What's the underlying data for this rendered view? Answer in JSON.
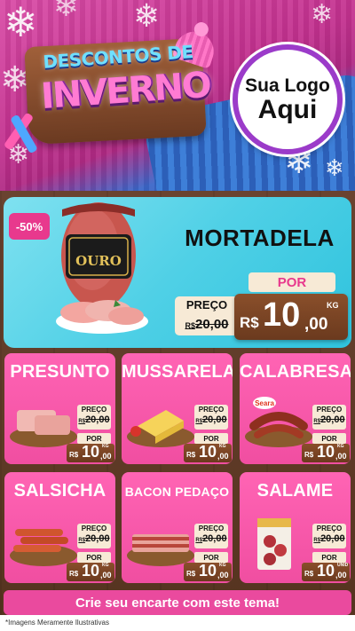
{
  "header": {
    "title_top": "DESCONTOS DE",
    "title_main": "INVERNO",
    "logo_line1": "Sua Logo",
    "logo_line2": "Aqui"
  },
  "featured": {
    "discount_badge": "-50%",
    "name": "MORTADELA",
    "preco_label": "PREÇO",
    "old_price": "20,00",
    "old_prefix": "R$",
    "por_label": "POR",
    "currency": "R$",
    "price_int": "10",
    "price_dec": ",00",
    "unit": "KG",
    "package_brand": "OURO"
  },
  "products": [
    {
      "name": "PRESUNTO",
      "preco_label": "PREÇO",
      "old_prefix": "R$",
      "old_price": "20,00",
      "por_label": "POR",
      "currency": "R$",
      "price_int": "10",
      "price_dec": ",00",
      "unit": "KG"
    },
    {
      "name": "MUSSARELA",
      "preco_label": "PREÇO",
      "old_prefix": "R$",
      "old_price": "20,00",
      "por_label": "POR",
      "currency": "R$",
      "price_int": "10",
      "price_dec": ",00",
      "unit": "KG"
    },
    {
      "name": "CALABRESA",
      "preco_label": "PREÇO",
      "old_prefix": "R$",
      "old_price": "20,00",
      "por_label": "POR",
      "currency": "R$",
      "price_int": "10",
      "price_dec": ",00",
      "unit": "KG",
      "brand": "Seara"
    },
    {
      "name": "SALSICHA",
      "preco_label": "PREÇO",
      "old_prefix": "R$",
      "old_price": "20,00",
      "por_label": "POR",
      "currency": "R$",
      "price_int": "10",
      "price_dec": ",00",
      "unit": "KG"
    },
    {
      "name": "BACON PEDAÇO",
      "preco_label": "PREÇO",
      "old_prefix": "R$",
      "old_price": "20,00",
      "por_label": "POR",
      "currency": "R$",
      "price_int": "10",
      "price_dec": ",00",
      "unit": "KG"
    },
    {
      "name": "SALAME",
      "preco_label": "PREÇO",
      "old_prefix": "R$",
      "old_price": "20,00",
      "por_label": "POR",
      "currency": "R$",
      "price_int": "10",
      "price_dec": ",00",
      "unit": "UNID"
    }
  ],
  "footer": {
    "cta": "Crie seu encarte com este tema!",
    "disclaimer": "*Imagens Meramente Ilustrativas"
  },
  "colors": {
    "pink": "#f04ea1",
    "cyan": "#4fd0e6",
    "wood": "#6b3a1e",
    "cream": "#f7ead6"
  }
}
